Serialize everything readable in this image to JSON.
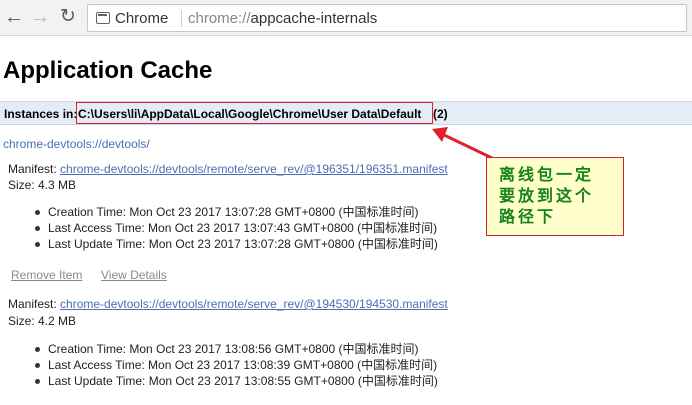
{
  "browser": {
    "site_chip": "Chrome",
    "url_scheme": "chrome://",
    "url_path": "appcache-internals"
  },
  "page": {
    "title": "Application Cache",
    "instances_label": "Instances in:",
    "instances_path": "C:\\Users\\li\\AppData\\Local\\Google\\Chrome\\User Data\\Default",
    "instances_count": "(2)",
    "origin": "chrome-devtools://devtools/"
  },
  "caches": [
    {
      "manifest_label": "Manifest:",
      "manifest_url": "chrome-devtools://devtools/remote/serve_rev/@196351/196351.manifest",
      "size": "Size: 4.3 MB",
      "times": [
        "Creation Time: Mon Oct 23 2017 13:07:28 GMT+0800 (中国标准时间)",
        "Last Access Time: Mon Oct 23 2017 13:07:43 GMT+0800 (中国标准时间)",
        "Last Update Time: Mon Oct 23 2017 13:07:28 GMT+0800 (中国标准时间)"
      ],
      "remove_label": "Remove Item",
      "details_label": "View Details"
    },
    {
      "manifest_label": "Manifest:",
      "manifest_url": "chrome-devtools://devtools/remote/serve_rev/@194530/194530.manifest",
      "size": "Size: 4.2 MB",
      "times": [
        "Creation Time: Mon Oct 23 2017 13:08:56 GMT+0800 (中国标准时间)",
        "Last Access Time: Mon Oct 23 2017 13:08:39 GMT+0800 (中国标准时间)",
        "Last Update Time: Mon Oct 23 2017 13:08:55 GMT+0800 (中国标准时间)"
      ]
    }
  ],
  "annotation": {
    "text": "离线包一定\n要放到这个\n路径下",
    "text_color": "#17821a",
    "border_color": "#d41f2c",
    "background": "#ffffcc"
  },
  "icons": {
    "back": "back-arrow-icon",
    "forward": "forward-arrow-icon",
    "reload": "reload-icon",
    "site": "page-icon"
  }
}
